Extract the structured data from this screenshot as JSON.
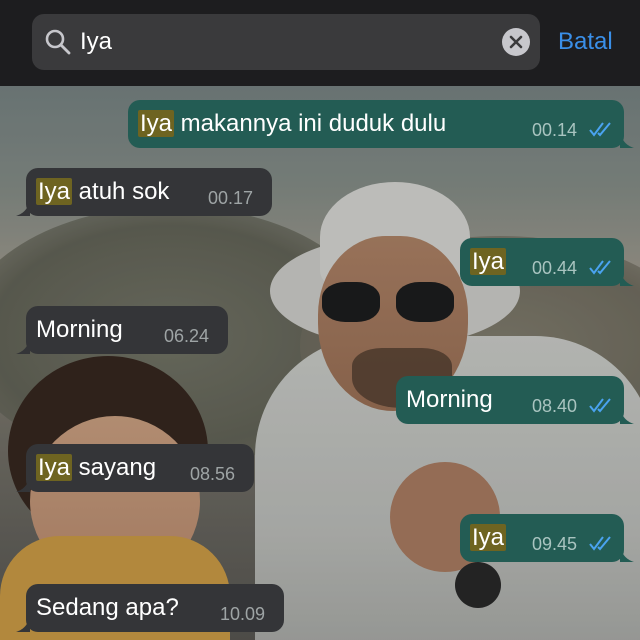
{
  "search": {
    "query": "Iya",
    "cancel_label": "Batal"
  },
  "icons": {
    "search": "search-icon",
    "clear": "clear-icon",
    "read_receipt": "double-check-icon"
  },
  "colors": {
    "header_bg": "#1d1d1f",
    "search_field_bg": "#3a3a3c",
    "accent": "#3a8fe8",
    "incoming_bubble": "#343538",
    "outgoing_bubble": "#235c54",
    "highlight": "#6e6421",
    "read_tick": "#4aa3f0"
  },
  "messages": [
    {
      "direction": "out",
      "highlight": "Iya",
      "text": " makannya ini duduk dulu",
      "time": "00.14",
      "read": true
    },
    {
      "direction": "in",
      "highlight": "Iya",
      "text": " atuh sok",
      "time": "00.17"
    },
    {
      "direction": "out",
      "highlight": "Iya",
      "text": "",
      "time": "00.44",
      "read": true
    },
    {
      "direction": "in",
      "highlight": "",
      "text": "Morning",
      "time": "06.24"
    },
    {
      "direction": "out",
      "highlight": "",
      "text": "Morning",
      "time": "08.40",
      "read": true
    },
    {
      "direction": "in",
      "highlight": "Iya",
      "text": " sayang",
      "time": "08.56"
    },
    {
      "direction": "out",
      "highlight": "Iya",
      "text": "",
      "time": "09.45",
      "read": true
    },
    {
      "direction": "in",
      "highlight": "",
      "text": "Sedang apa?",
      "time": "10.09"
    }
  ]
}
